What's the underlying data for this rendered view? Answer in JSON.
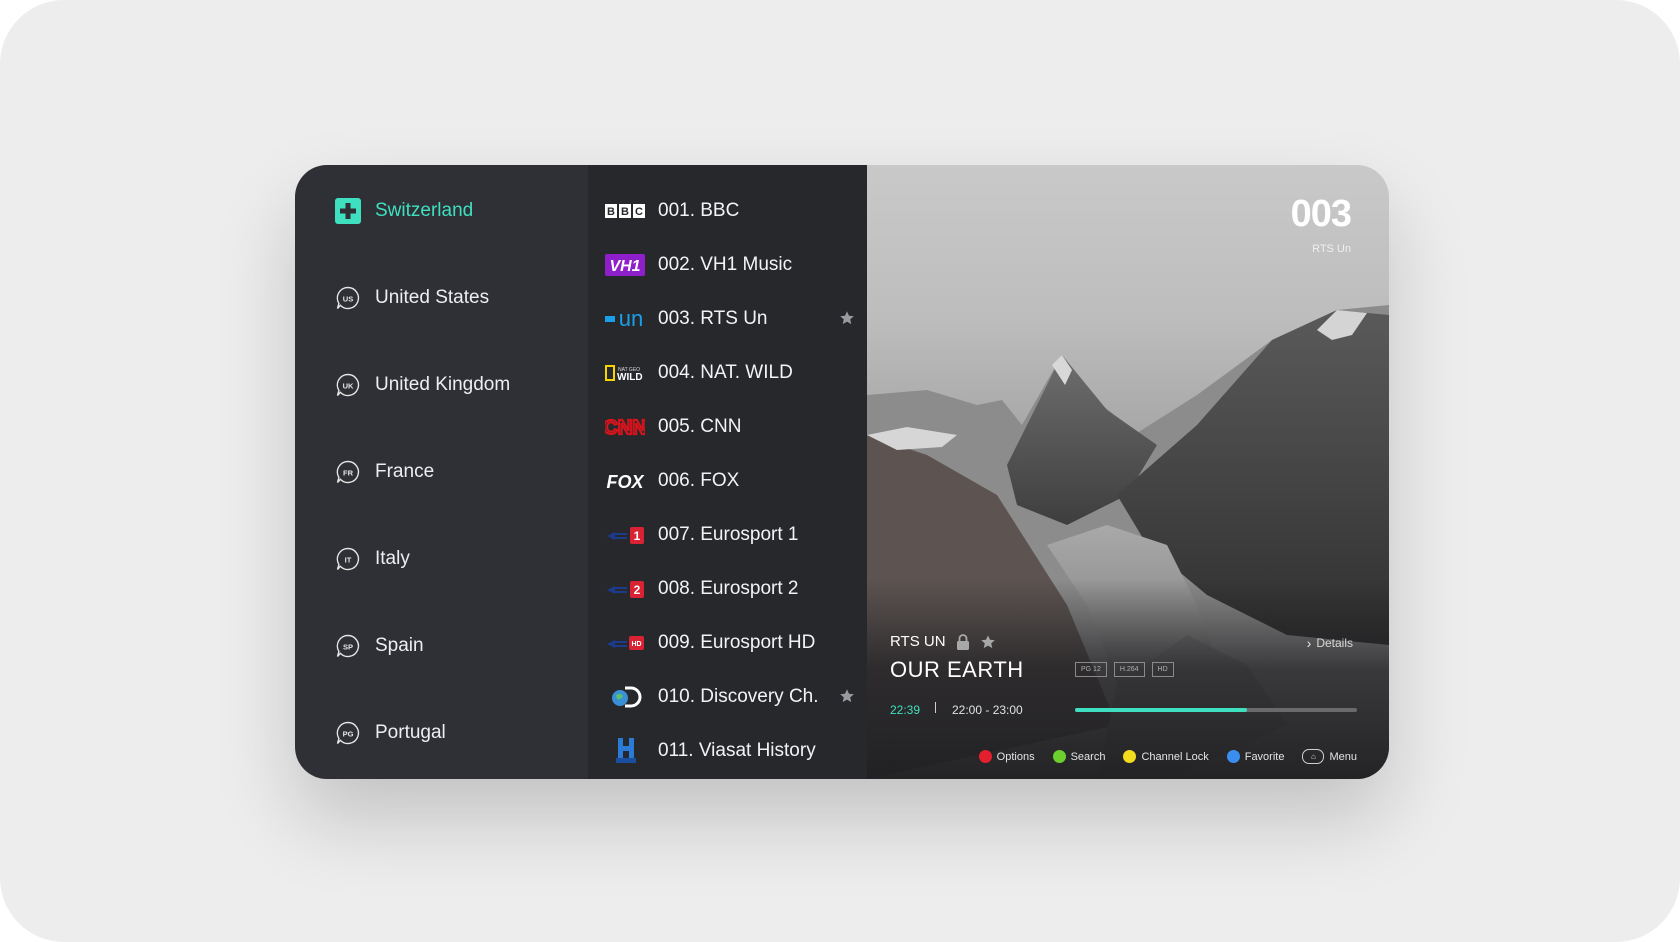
{
  "regions": [
    {
      "label": "Switzerland",
      "code": "",
      "active": true
    },
    {
      "label": "United States",
      "code": "US"
    },
    {
      "label": "United Kingdom",
      "code": "UK"
    },
    {
      "label": "France",
      "code": "FR"
    },
    {
      "label": "Italy",
      "code": "IT"
    },
    {
      "label": "Spain",
      "code": "SP"
    },
    {
      "label": "Portugal",
      "code": "PG"
    }
  ],
  "channels": [
    {
      "label": "001. BBC",
      "logo_text": "BBC",
      "logo": "bbc-logo",
      "favorite": false
    },
    {
      "label": "002. VH1 Music",
      "logo_text": "VH1",
      "logo": "vh1-logo",
      "favorite": false
    },
    {
      "label": "003. RTS Un",
      "logo_text": "un",
      "logo": "rts-un-logo",
      "favorite": true
    },
    {
      "label": "004. NAT. WILD",
      "logo_text": "WILD",
      "logo": "nat-geo-wild-logo",
      "favorite": false
    },
    {
      "label": "005. CNN",
      "logo_text": "CNN",
      "logo": "cnn-logo",
      "favorite": false
    },
    {
      "label": "006. FOX",
      "logo_text": "FOX",
      "logo": "fox-logo",
      "favorite": false
    },
    {
      "label": "007. Eurosport 1",
      "logo_text": "1",
      "logo": "eurosport-1-logo",
      "favorite": false
    },
    {
      "label": "008. Eurosport 2",
      "logo_text": "2",
      "logo": "eurosport-2-logo",
      "favorite": false
    },
    {
      "label": "009. Eurosport HD",
      "logo_text": "HD",
      "logo": "eurosport-hd-logo",
      "favorite": false
    },
    {
      "label": "010. Discovery Ch.",
      "logo_text": "D",
      "logo": "discovery-logo",
      "favorite": true
    },
    {
      "label": "011. Viasat History",
      "logo_text": "H",
      "logo": "viasat-history-logo",
      "favorite": false
    }
  ],
  "preview": {
    "channel_number": "003",
    "channel_name": "RTS Un",
    "program_channel": "RTS UN",
    "program_title": "OUR EARTH",
    "details_label": "Details",
    "badges": [
      "PG 12",
      "H.264",
      "HD"
    ],
    "current_time": "22:39",
    "time_range": "22:00 - 23:00",
    "progress": 0.61
  },
  "keys": [
    {
      "label": "Options",
      "color": "#e5202e"
    },
    {
      "label": "Search",
      "color": "#6ccf2d"
    },
    {
      "label": "Channel Lock",
      "color": "#f3dc1e"
    },
    {
      "label": "Favorite",
      "color": "#3a8ef0"
    },
    {
      "label": "Menu",
      "icon": "home-icon"
    }
  ],
  "colors": {
    "accent": "#3ee0bf",
    "panel": "#2f3035",
    "list": "#27282c"
  }
}
